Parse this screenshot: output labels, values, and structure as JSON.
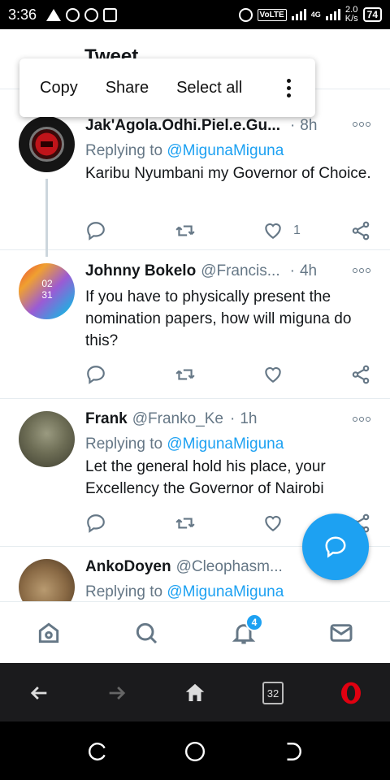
{
  "status_bar": {
    "time": "3:36",
    "network_label": "VoLTE",
    "net_type": "4G",
    "speed_value": "2.0",
    "speed_unit": "K/s",
    "battery": "74"
  },
  "header": {
    "title": "Tweet"
  },
  "context_menu": {
    "items": [
      "Copy",
      "Share",
      "Select all"
    ]
  },
  "tweets": [
    {
      "name": "Jak'Agola.Odhi.Piel.e.Gu...",
      "handle": "",
      "age": "8h",
      "replying_prefix": "Replying to",
      "replying_to": "@MigunaMiguna",
      "text": "Karibu Nyumbani my Governor of Choice.",
      "like_count": "1"
    },
    {
      "name": "Johnny Bokelo",
      "handle": "@Francis...",
      "age": "4h",
      "replying_prefix": "",
      "replying_to": "",
      "text": "If you have to physically present the nomination papers, how will miguna do this?",
      "avatar_text": "02 31",
      "like_count": ""
    },
    {
      "name": "Frank",
      "handle": "@Franko_Ke",
      "age": "1h",
      "replying_prefix": "Replying to",
      "replying_to": "@MigunaMiguna",
      "text": "Let the general hold his place, your Excellency the Governor of Nairobi",
      "like_count": ""
    },
    {
      "name": "AnkoDoyen",
      "handle": "@Cleophasm...",
      "age": "",
      "replying_prefix": "Replying to",
      "replying_to": "@MigunaMiguna",
      "text": ""
    }
  ],
  "bottom_nav": {
    "notification_badge": "4"
  },
  "browser_bar": {
    "tab_count": "32"
  },
  "colors": {
    "accent": "#1da1f2",
    "secondary_text": "#657786",
    "divider": "#e6ecf0",
    "opera_red": "#e00010"
  }
}
